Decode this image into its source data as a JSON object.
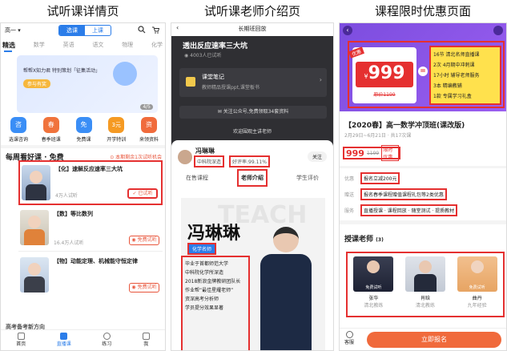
{
  "panels": {
    "p1": "试听课详情页",
    "p2": "试听课老师介绍页",
    "p3": "课程限时优惠页面"
  },
  "p1": {
    "grade": "高一",
    "tab_sel": "选课",
    "tab_other": "上课",
    "subjects": [
      "精选",
      "数学",
      "英语",
      "语文",
      "物理",
      "化学"
    ],
    "banner_text": "帮帮X知力君 特别策划「征集活动」",
    "banner_btn": "参与有奖",
    "banner_page": "4/5",
    "icons": [
      "选课咨询",
      "春季班课",
      "免费课",
      "开学特训",
      "来领资料"
    ],
    "icon_glyphs": [
      "咨",
      "春",
      "免",
      "3元",
      "资"
    ],
    "section_title": "每周看好课 · 免费",
    "section_link": "本期剩余1次试听机会",
    "courses": [
      {
        "title": "【化】速解反应速率三大坑",
        "count": "4万人试听",
        "btn": "已试听"
      },
      {
        "title": "【数】等比数列",
        "count": "16.4万人试听",
        "btn": "免费试听"
      },
      {
        "title": "【物】动能定理、机械能守恒定律",
        "count": "",
        "btn": "免费试听"
      }
    ],
    "footer_hint": "高考备考新方向",
    "nav": [
      "首页",
      "直播课",
      "练习",
      "我"
    ]
  },
  "p2": {
    "topbar": "长期班回放",
    "title": "透出反应速率三大坑",
    "count": "4003人已试听",
    "note_title": "课堂笔记",
    "note_sub": "教师精品授课ppt,课堂板书",
    "wechat": "关注公众号,免费领取34套资料",
    "welcome": "欢迎围观主讲老师",
    "teacher": "冯琳琳",
    "tag1": "中科院深造",
    "tag2": "好评率:99.11%",
    "follow": "关注",
    "tabs": [
      "在售课程",
      "老师介绍",
      "学生评价"
    ],
    "big_name": "冯琳琳",
    "title_badge": "化学名师",
    "bg_word": "TEACH",
    "bullets": [
      "毕业于首都师范大学",
      "中科院化学所深造",
      "2018新浪金牌教研团队长",
      "作业帮“最佳星耀老师”",
      "资深高考分析师",
      "学员提分效果显著"
    ]
  },
  "p3": {
    "price": "999",
    "price_unit": "¥",
    "old_price": "原价1199",
    "coupon": "优惠",
    "perks": [
      "16节 清北名师直播课",
      "2次 4月期中冲刺课",
      "17小时 辅导老师服务",
      "3本 精编教辅",
      "1款 专属学习礼盒"
    ],
    "course_title": "【2020春】高一数学冲顶班(课改版)",
    "date": "2月29日~6月21日 · 共17次课",
    "cur_price": "999",
    "strike": "1199",
    "limit": "限时优惠",
    "rows": [
      {
        "label": "优惠",
        "value": "报名立减200元"
      },
      {
        "label": "赠送",
        "value": "报名春季课程赠值课程礼包等2类优惠"
      },
      {
        "label": "服务",
        "value": "直播授课 · 课程回放 · 随堂测试 · 提质教材"
      }
    ],
    "teachers_title": "授课老师",
    "teachers_count": "(3)",
    "teachers": [
      {
        "name": "张华",
        "sub": "清北教练",
        "tag": "免费试听"
      },
      {
        "name": "肖晗",
        "sub": "清北教练",
        "tag": ""
      },
      {
        "name": "曲丹",
        "sub": "九年经验",
        "tag": "免费试听"
      }
    ],
    "cs": "客服",
    "cta": "立即报名"
  }
}
